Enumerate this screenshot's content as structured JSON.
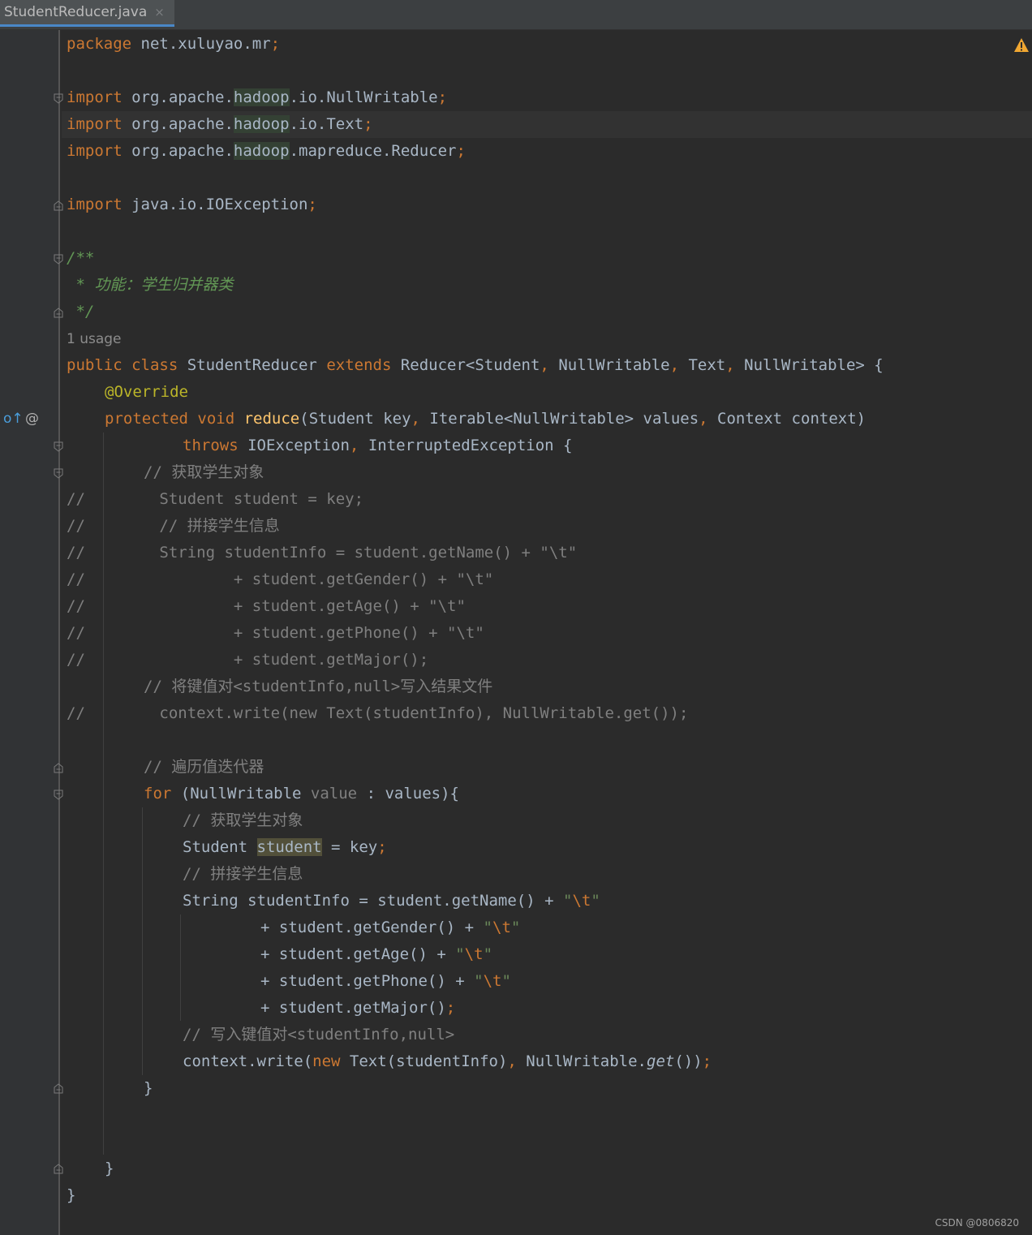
{
  "tab": {
    "filename": "StudentReducer.java",
    "close_glyph": "×"
  },
  "gutter": {
    "override_marker": "o↑",
    "annotation_marker": "@"
  },
  "inspection_icon": "warning-triangle-icon",
  "usage_hint": "1 usage",
  "watermark": "CSDN @0806820",
  "code": {
    "l01": [
      "package",
      " net.xuluyao.mr",
      ";"
    ],
    "l03": [
      "import",
      " org.apache.",
      "hadoop",
      ".io.NullWritable",
      ";"
    ],
    "l04": [
      "import",
      " org.apache.",
      "hadoop",
      ".io.Text",
      ";"
    ],
    "l05": [
      "import",
      " org.apache.",
      "hadoop",
      ".mapreduce.Reducer",
      ";"
    ],
    "l07": [
      "import",
      " java.io.IOException",
      ";"
    ],
    "l09": "/**",
    "l10": " * 功能：学生归并器类",
    "l11": " */",
    "l12": [
      "public class",
      " StudentReducer ",
      "extends",
      " Reducer<Student",
      ",",
      " NullWritable",
      ",",
      " Text",
      ",",
      " NullWritable> {"
    ],
    "l13": "@Override",
    "l14": [
      "protected void",
      " ",
      "reduce",
      "(Student key",
      ",",
      " Iterable<NullWritable> values",
      ",",
      " Context context)"
    ],
    "l15": [
      "throws",
      " IOException",
      ",",
      " InterruptedException {"
    ],
    "l16": "// 获取学生对象",
    "l17": [
      "//",
      "        Student student = key;"
    ],
    "l18": [
      "//",
      "        // 拼接学生信息"
    ],
    "l19": [
      "//",
      "        String studentInfo = student.getName() + \"\\t\""
    ],
    "l20": [
      "//",
      "                + student.getGender() + \"\\t\""
    ],
    "l21": [
      "//",
      "                + student.getAge() + \"\\t\""
    ],
    "l22": [
      "//",
      "                + student.getPhone() + \"\\t\""
    ],
    "l23": [
      "//",
      "                + student.getMajor();"
    ],
    "l24": "// 将键值对<studentInfo,null>写入结果文件",
    "l25": [
      "//",
      "        context.write(new Text(studentInfo), NullWritable.get());"
    ],
    "l27": "// 遍历值迭代器",
    "l28": [
      "for",
      " (NullWritable ",
      "value",
      " : values){"
    ],
    "l29": "// 获取学生对象",
    "l30": [
      "Student ",
      "student",
      " = key",
      ";"
    ],
    "l31": "// 拼接学生信息",
    "l32": [
      "String studentInfo = student.getName() + ",
      "\"",
      "\\t",
      "\""
    ],
    "l33": [
      "+ student.getGender() + ",
      "\"",
      "\\t",
      "\""
    ],
    "l34": [
      "+ student.getAge() + ",
      "\"",
      "\\t",
      "\""
    ],
    "l35": [
      "+ student.getPhone() + ",
      "\"",
      "\\t",
      "\""
    ],
    "l36": [
      "+ student.getMajor()",
      ";"
    ],
    "l37": "// 写入键值对<studentInfo,null>",
    "l38": [
      "context.write(",
      "new",
      " Text(studentInfo)",
      ",",
      " NullWritable.",
      "get",
      "())",
      ";"
    ],
    "l39": "}",
    "l42": "}",
    "l43": "}"
  }
}
